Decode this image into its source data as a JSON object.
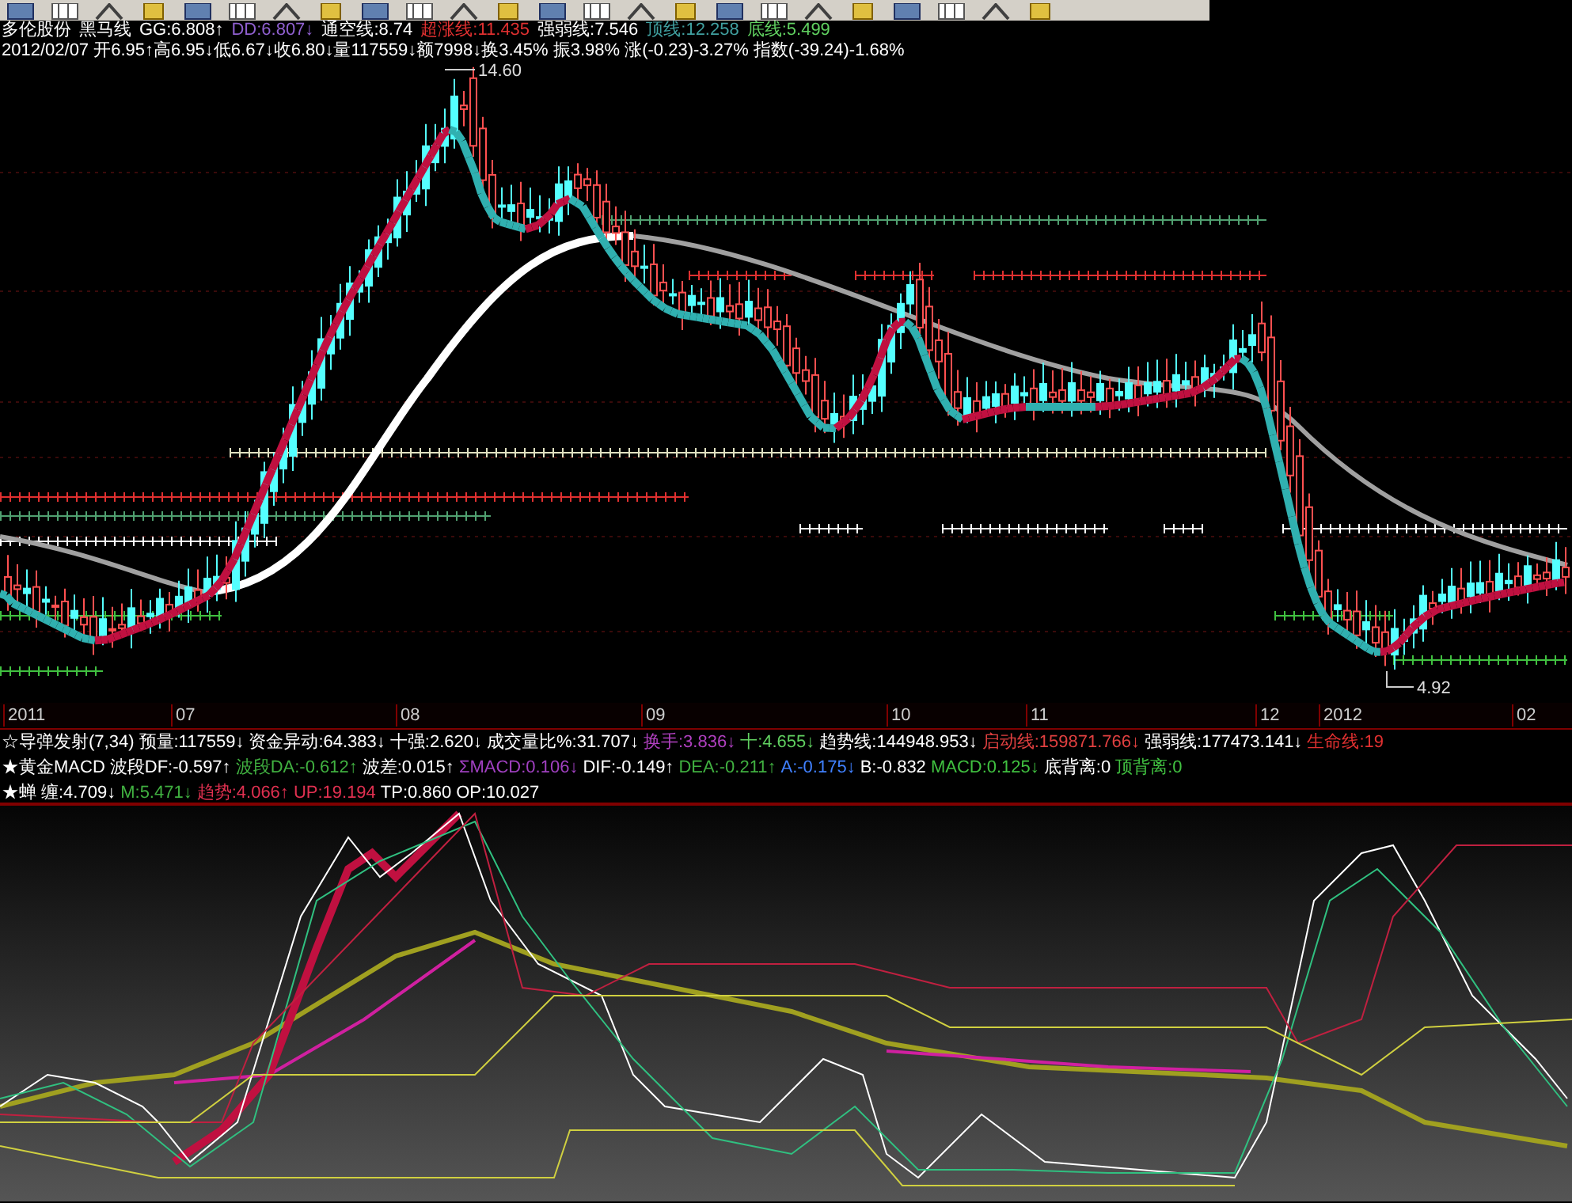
{
  "header": {
    "rows": [
      [
        {
          "text": "多伦股份",
          "color": "#ffffff"
        },
        {
          "text": "黑马线",
          "color": "#ffffff"
        },
        {
          "text": "GG:6.808↑",
          "color": "#ffffff"
        },
        {
          "text": "DD:6.807↓",
          "color": "#9060d0"
        },
        {
          "text": "通空线:8.74",
          "color": "#ffffff"
        },
        {
          "text": "超涨线:11.435",
          "color": "#e03030"
        },
        {
          "text": "强弱线:7.546",
          "color": "#ffffff"
        },
        {
          "text": "顶线:12.258",
          "color": "#40a0a0"
        },
        {
          "text": "底线:5.499",
          "color": "#60d060"
        }
      ],
      [
        {
          "text": "2012/02/07 开6.95↑高6.95↓低6.67↓收6.80↓量117559↓额7998↓换3.45% 振3.98% 涨(-0.23)-3.27% 指数(-39.24)-1.68%",
          "color": "#ffffff"
        }
      ]
    ]
  },
  "price_labels": [
    {
      "text": "14.60"
    },
    {
      "text": "4.92"
    }
  ],
  "x_axis": [
    "2011",
    "07",
    "08",
    "09",
    "10",
    "11",
    "12",
    "2012",
    "02"
  ],
  "indicators": [
    [
      {
        "text": "☆导弹发射(7,34)",
        "color": "#ffffff"
      },
      {
        "text": "预量:117559↓",
        "color": "#ffffff"
      },
      {
        "text": "资金异动:64.383↓",
        "color": "#ffffff"
      },
      {
        "text": "十强:2.620↓",
        "color": "#ffffff"
      },
      {
        "text": "成交量比%:31.707↓",
        "color": "#ffffff"
      },
      {
        "text": "换手:3.836↓",
        "color": "#b040c0"
      },
      {
        "text": "十:4.655↓",
        "color": "#60d060"
      },
      {
        "text": "趋势线:144948.953↓",
        "color": "#ffffff"
      },
      {
        "text": "启动线:159871.766↓",
        "color": "#e04040"
      },
      {
        "text": "强弱线:177473.141↓",
        "color": "#ffffff"
      },
      {
        "text": "生命线:19",
        "color": "#e03030"
      }
    ],
    [
      {
        "text": "★黄金MACD",
        "color": "#ffffff"
      },
      {
        "text": "波段DF:-0.597↑",
        "color": "#ffffff"
      },
      {
        "text": "波段DA:-0.612↑",
        "color": "#40b040"
      },
      {
        "text": "波差:0.015↑",
        "color": "#ffffff"
      },
      {
        "text": "ΣMACD:0.106↓",
        "color": "#a040c0"
      },
      {
        "text": "DIF:-0.149↑",
        "color": "#ffffff"
      },
      {
        "text": "DEA:-0.211↑",
        "color": "#40b040"
      },
      {
        "text": "A:-0.175↓",
        "color": "#4080ff"
      },
      {
        "text": "B:-0.832",
        "color": "#ffffff"
      },
      {
        "text": "MACD:0.125↓",
        "color": "#40c040"
      },
      {
        "text": "底背离:0",
        "color": "#ffffff"
      },
      {
        "text": "顶背离:0",
        "color": "#40c040"
      }
    ],
    [
      {
        "text": "★蝉",
        "color": "#ffffff"
      },
      {
        "text": "缠:4.709↓",
        "color": "#ffffff"
      },
      {
        "text": "M:5.471↓",
        "color": "#40b040"
      },
      {
        "text": "趋势:4.066↑",
        "color": "#e03050"
      },
      {
        "text": "UP:19.194",
        "color": "#e03050"
      },
      {
        "text": "TP:0.860",
        "color": "#ffffff"
      },
      {
        "text": "OP:10.027",
        "color": "#ffffff"
      }
    ]
  ]
}
